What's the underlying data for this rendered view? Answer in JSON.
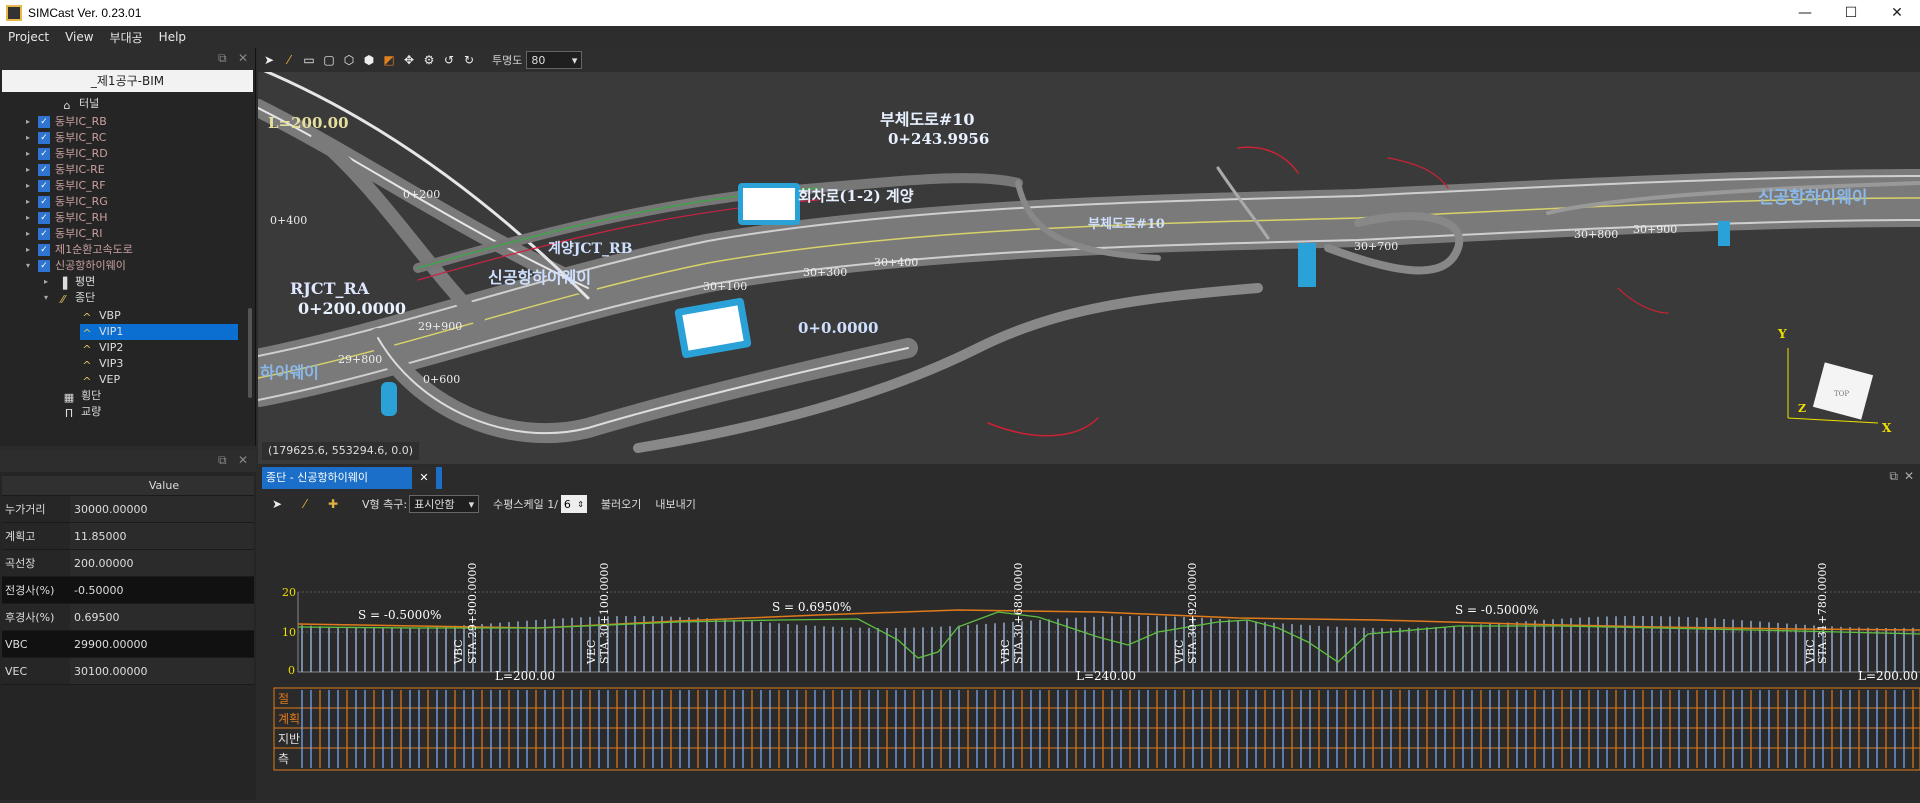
{
  "window": {
    "title": "SIMCast Ver. 0.23.01"
  },
  "menu": [
    "Project",
    "View",
    "부대공",
    "Help"
  ],
  "tree": {
    "root": "_제1공구-BIM",
    "tunnel": "터널",
    "items": [
      "동부IC_RB",
      "동부IC_RC",
      "동부IC_RD",
      "동부IC-RE",
      "동부IC_RF",
      "동부IC_RG",
      "동부IC_RH",
      "동부IC_RI",
      "제1순환고속도로",
      "신공항하이웨이"
    ],
    "plan": "평면",
    "profile": "종단",
    "vips": [
      "VBP",
      "VIP1",
      "VIP2",
      "VIP3",
      "VEP"
    ],
    "cross": "횡단",
    "bridge": "교량",
    "selected": "VIP1"
  },
  "props": {
    "header": "Value",
    "rows": [
      {
        "k": "누가거리",
        "v": "30000.00000"
      },
      {
        "k": "계획고",
        "v": "11.85000"
      },
      {
        "k": "곡선장",
        "v": "200.00000"
      },
      {
        "k": "전경사(%)",
        "v": "-0.50000"
      },
      {
        "k": "후경사(%)",
        "v": "0.69500"
      },
      {
        "k": "VBC",
        "v": "29900.00000"
      },
      {
        "k": "VEC",
        "v": "30100.00000"
      }
    ]
  },
  "toolbar3d": {
    "opacity_label": "투명도",
    "opacity_value": "80"
  },
  "viewport": {
    "coord": "(179625.6, 553294.6, 0.0)",
    "labels": {
      "l1": "부체도로#10",
      "l2": "0+243.9956",
      "l3": "회차로(1-2) 계양",
      "l4": "신공항하이웨이",
      "l5": "RJCT_RA",
      "l6": "0+200.0000",
      "l7": "0+0.0000",
      "l8": "L=200.00",
      "l9": "부체도로#10",
      "l10": "신공항하이웨이",
      "l11": "계양JCT_RB",
      "l12": "30+100",
      "l13": "30+300",
      "l14": "30+400",
      "l15": "30+700",
      "l16": "30+800",
      "l17": "30+900",
      "l18": "29+900",
      "l19": "29+800",
      "l20": "0+600",
      "l21": "0+400",
      "l22": "0+200",
      "l23": "하이웨이",
      "l24": "Y",
      "l25": "X",
      "l26": "Z",
      "l27": "TOP"
    }
  },
  "lower": {
    "tab": "종단 - 신공항하이웨이",
    "tab_close": "✕",
    "v_label": "V형 측구:",
    "v_value": "표시안함",
    "scale_label": "수평스케일 1/",
    "scale_value": "6",
    "load": "불러오기",
    "export": "내보내기"
  },
  "profile_labels": {
    "y20": "20",
    "y10": "10",
    "y0": "0",
    "s1": "S = -0.5000%",
    "s2": "S = 0.6950%",
    "s3": "S = -0.5000%",
    "l1": "L=200.00",
    "l2": "L=240.00",
    "l3": "L=200.00",
    "sta1": "STA.29+900.0000",
    "sta2": "STA.30+100.0000",
    "sta3": "STA.30+680.0000",
    "sta4": "STA.30+920.0000",
    "sta5": "STA.31+780.0000",
    "vbc": "VBC",
    "vec": "VEC",
    "r1": "절",
    "r2": "계획",
    "r3": "지반",
    "r4": "측"
  }
}
